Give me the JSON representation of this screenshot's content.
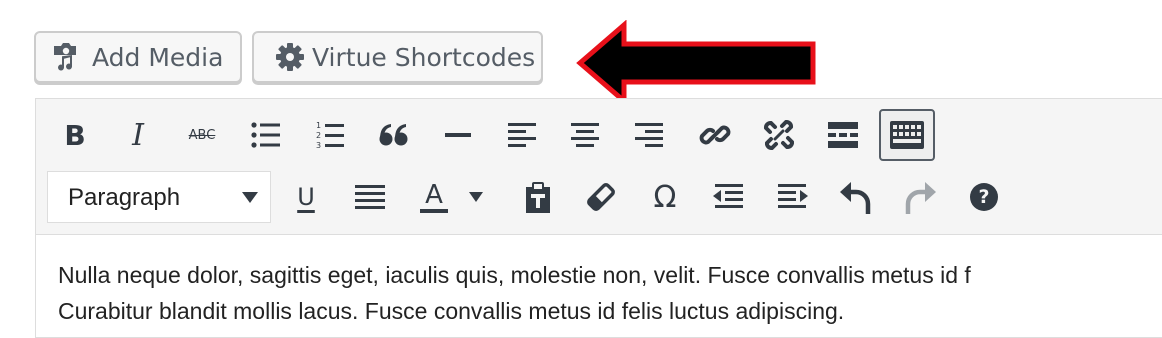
{
  "media_buttons": {
    "add_media": {
      "label": "Add Media",
      "icon": "camera-music-icon"
    },
    "virtue_shortcodes": {
      "label": "Virtue Shortcodes",
      "icon": "gear-icon"
    }
  },
  "annotation": {
    "icon": "left-arrow-icon",
    "fill": "#000000",
    "stroke": "#e8101a"
  },
  "toolbar": {
    "row1": [
      "bold",
      "italic",
      "strikethrough",
      "bulleted-list",
      "numbered-list",
      "blockquote",
      "horizontal-line",
      "align-left",
      "align-center",
      "align-right",
      "insert-link",
      "remove-link",
      "read-more",
      "toolbar-toggle"
    ],
    "row1_italic_text": "I",
    "row1_bold_text": "B",
    "row1_strike_text": "ABC",
    "row1_numbers": [
      "1",
      "2",
      "3"
    ],
    "format_select": {
      "value": "Paragraph"
    },
    "row2": [
      "underline",
      "justify",
      "text-color",
      "text-color-dropdown",
      "paste-as-text",
      "clear-formatting",
      "special-character",
      "decrease-indent",
      "increase-indent",
      "undo",
      "redo",
      "help"
    ],
    "underline_text": "U",
    "text_color_text": "A",
    "omega_text": "Ω",
    "help_text": "?",
    "toggle_state": "active"
  },
  "content": {
    "lines": [
      "Nulla neque dolor, sagittis eget, iaculis quis, molestie non, velit. Fusce convallis metus id f",
      "Curabitur blandit mollis lacus. Fusce convallis metus id felis luctus adipiscing."
    ]
  },
  "colors": {
    "icon": "#333b44",
    "toolbar_bg": "#f5f5f5",
    "button_bg": "#f7f7f7",
    "disabled": "#a0a5aa"
  }
}
